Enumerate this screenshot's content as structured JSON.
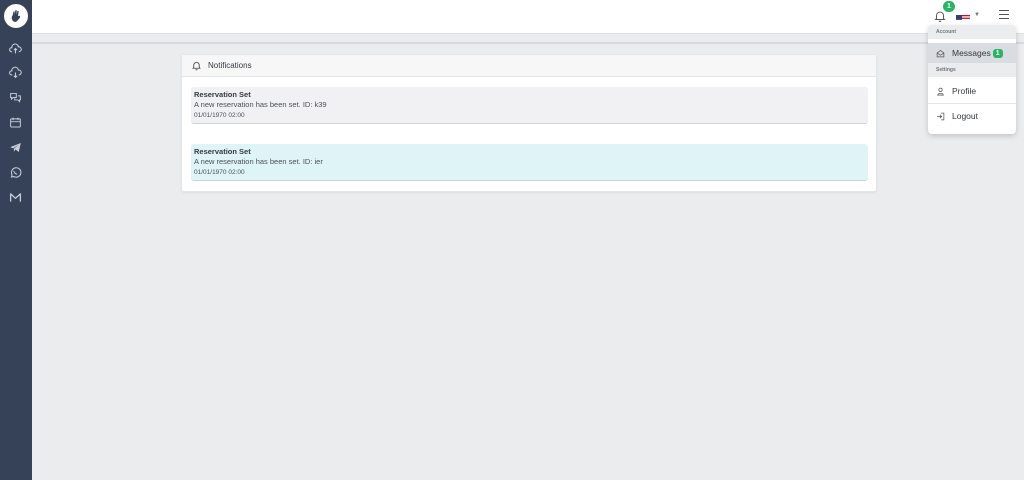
{
  "sidebar": {
    "logo": "hand-logo-icon",
    "items": [
      {
        "icon": "cloud-upload-icon"
      },
      {
        "icon": "cloud-download-icon"
      },
      {
        "icon": "chat-icon"
      },
      {
        "icon": "calendar-icon"
      },
      {
        "icon": "telegram-icon"
      },
      {
        "icon": "whatsapp-icon"
      },
      {
        "icon": "gmail-icon"
      }
    ]
  },
  "header": {
    "notifications_count": "1",
    "flag_icon": "us-flag-icon",
    "menu_icon": "hamburger-icon"
  },
  "notifications": {
    "title": "Notifications",
    "items": [
      {
        "title": "Reservation Set",
        "body": "A new reservation has been set. ID: k39",
        "time": "01/01/1970 02:00"
      },
      {
        "title": "Reservation Set",
        "body": "A new reservation has been set. ID: ier",
        "time": "01/01/1970 02:00"
      }
    ]
  },
  "user_menu": {
    "account_header": "Account",
    "messages_label": "Messages",
    "messages_count": "1",
    "settings_header": "Settings",
    "profile_label": "Profile",
    "logout_label": "Logout"
  },
  "colors": {
    "sidebar": "#364257",
    "badge": "#28b463",
    "highlight": "#dff4f7"
  }
}
